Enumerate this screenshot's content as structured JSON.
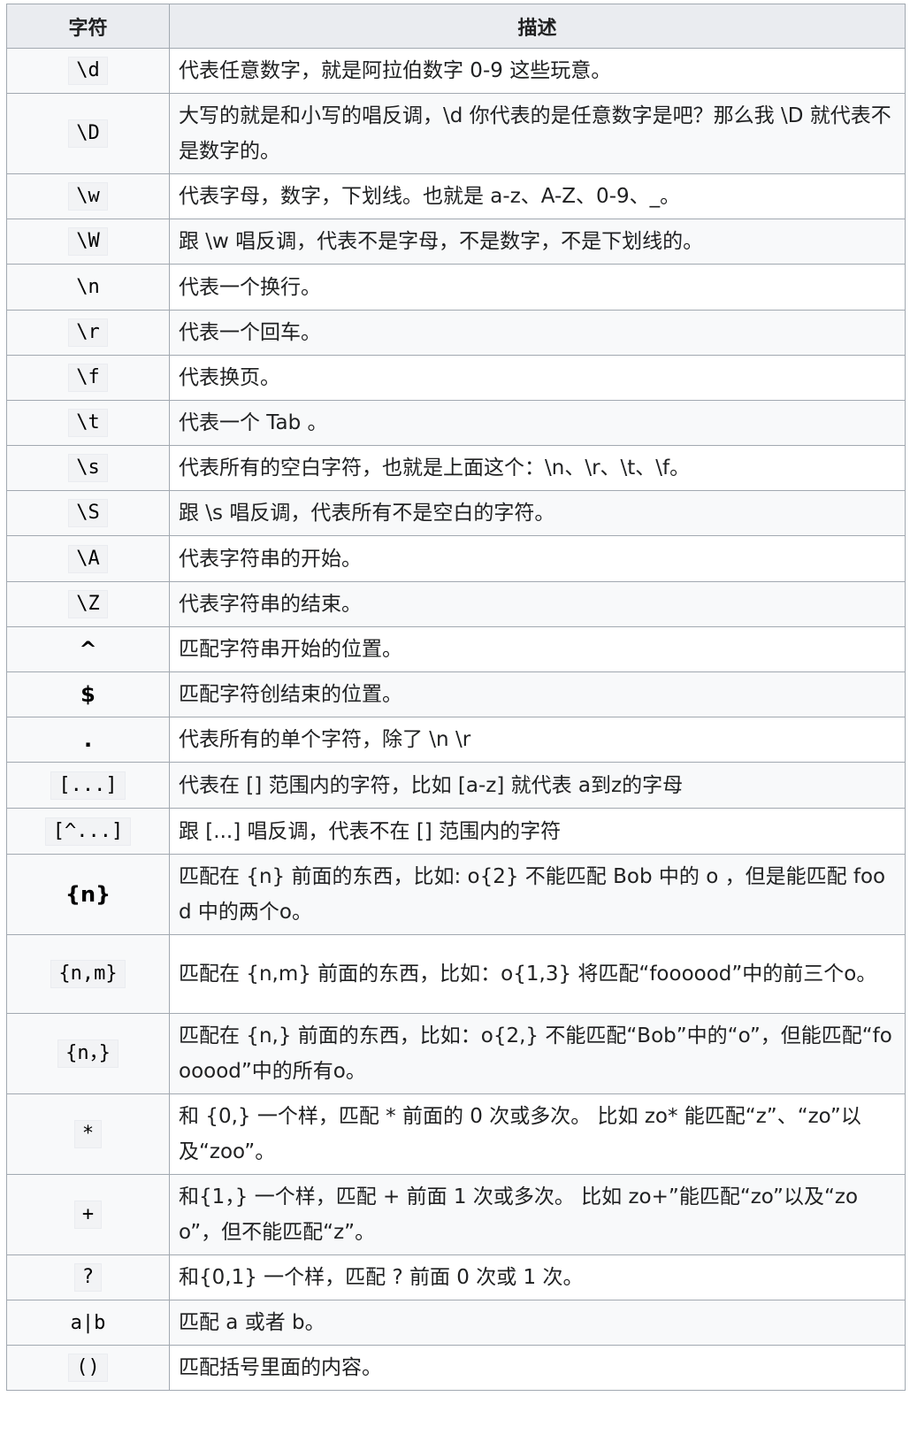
{
  "table": {
    "headers": [
      "字符",
      "描述"
    ],
    "rows": [
      {
        "symbol": "\\d",
        "style": "code",
        "desc": "代表任意数字，就是阿拉伯数字 0-9 这些玩意。",
        "h": 51
      },
      {
        "symbol": "\\D",
        "style": "code",
        "desc": "大写的就是和小写的唱反调，\\d 你代表的是任意数字是吧？那么我 \\D 就代表不是数字的。",
        "h": 90
      },
      {
        "symbol": "\\w",
        "style": "code",
        "desc": "代表字母，数字，下划线。也就是 a-z、A-Z、0-9、_。",
        "h": 51
      },
      {
        "symbol": "\\W",
        "style": "code",
        "desc": "跟 \\w 唱反调，代表不是字母，不是数字，不是下划线的。",
        "h": 51
      },
      {
        "symbol": "\\n",
        "style": "plain",
        "desc": "代表一个换行。",
        "h": 52
      },
      {
        "symbol": "\\r",
        "style": "code",
        "desc": "代表一个回车。",
        "h": 51
      },
      {
        "symbol": "\\f",
        "style": "code",
        "desc": "代表换页。",
        "h": 51
      },
      {
        "symbol": "\\t",
        "style": "code",
        "desc": "代表一个 Tab 。",
        "h": 51
      },
      {
        "symbol": "\\s",
        "style": "code",
        "desc": "代表所有的空白字符，也就是上面这个：\\n、\\r、\\t、\\f。",
        "h": 51
      },
      {
        "symbol": "\\S",
        "style": "code",
        "desc": "跟 \\s 唱反调，代表所有不是空白的字符。",
        "h": 51
      },
      {
        "symbol": "\\A",
        "style": "code",
        "desc": "代表字符串的开始。",
        "h": 52
      },
      {
        "symbol": "\\Z",
        "style": "code",
        "desc": "代表字符串的结束。",
        "h": 50
      },
      {
        "symbol": "^",
        "style": "bold",
        "desc": "匹配字符串开始的位置。",
        "h": 50
      },
      {
        "symbol": "$",
        "style": "bold",
        "desc": "匹配字符创结束的位置。",
        "h": 51
      },
      {
        "symbol": ".",
        "style": "bold",
        "desc": "代表所有的单个字符，除了 \\n \\r",
        "h": 51
      },
      {
        "symbol": "[...]",
        "style": "code",
        "desc": "代表在 [] 范围内的字符，比如 [a-z] 就代表 a到z的字母",
        "h": 52
      },
      {
        "symbol": "[^...]",
        "style": "code",
        "desc": "跟 [...] 唱反调，代表不在 [] 范围内的字符",
        "h": 52
      },
      {
        "symbol": "{n}",
        "style": "bold",
        "desc": "匹配在 {n} 前面的东西，比如: o{2} 不能匹配 Bob 中的 o ，但是能匹配 food 中的两个o。",
        "h": 88
      },
      {
        "symbol": "{n,m}",
        "style": "code",
        "desc": "匹配在 {n,m} 前面的东西，比如：o{1,3} 将匹配“foooood”中的前三个o。",
        "h": 89
      },
      {
        "symbol": "{n，}",
        "style": "code",
        "desc": "匹配在 {n,} 前面的东西，比如：o{2,} 不能匹配“Bob”中的“o”，但能匹配“foooood”中的所有o。",
        "h": 89
      },
      {
        "symbol": "*",
        "style": "code",
        "desc": "和 {0,} 一个样，匹配 * 前面的 0 次或多次。 比如 zo* 能匹配“z”、“zo”以及“zoo”。",
        "h": 88
      },
      {
        "symbol": "+",
        "style": "code",
        "desc": "和{1，} 一个样，匹配 + 前面 1 次或多次。 比如 zo+”能匹配“zo”以及“zoo”，但不能匹配“z”。",
        "h": 90
      },
      {
        "symbol": "?",
        "style": "code",
        "desc": "和{0,1} 一个样，匹配 ? 前面 0 次或 1 次。",
        "h": 51
      },
      {
        "symbol": "a|b",
        "style": "plain",
        "desc": "匹配 a 或者 b。",
        "h": 51
      },
      {
        "symbol": "()",
        "style": "code",
        "desc": "匹配括号里面的内容。",
        "h": 51
      }
    ]
  }
}
